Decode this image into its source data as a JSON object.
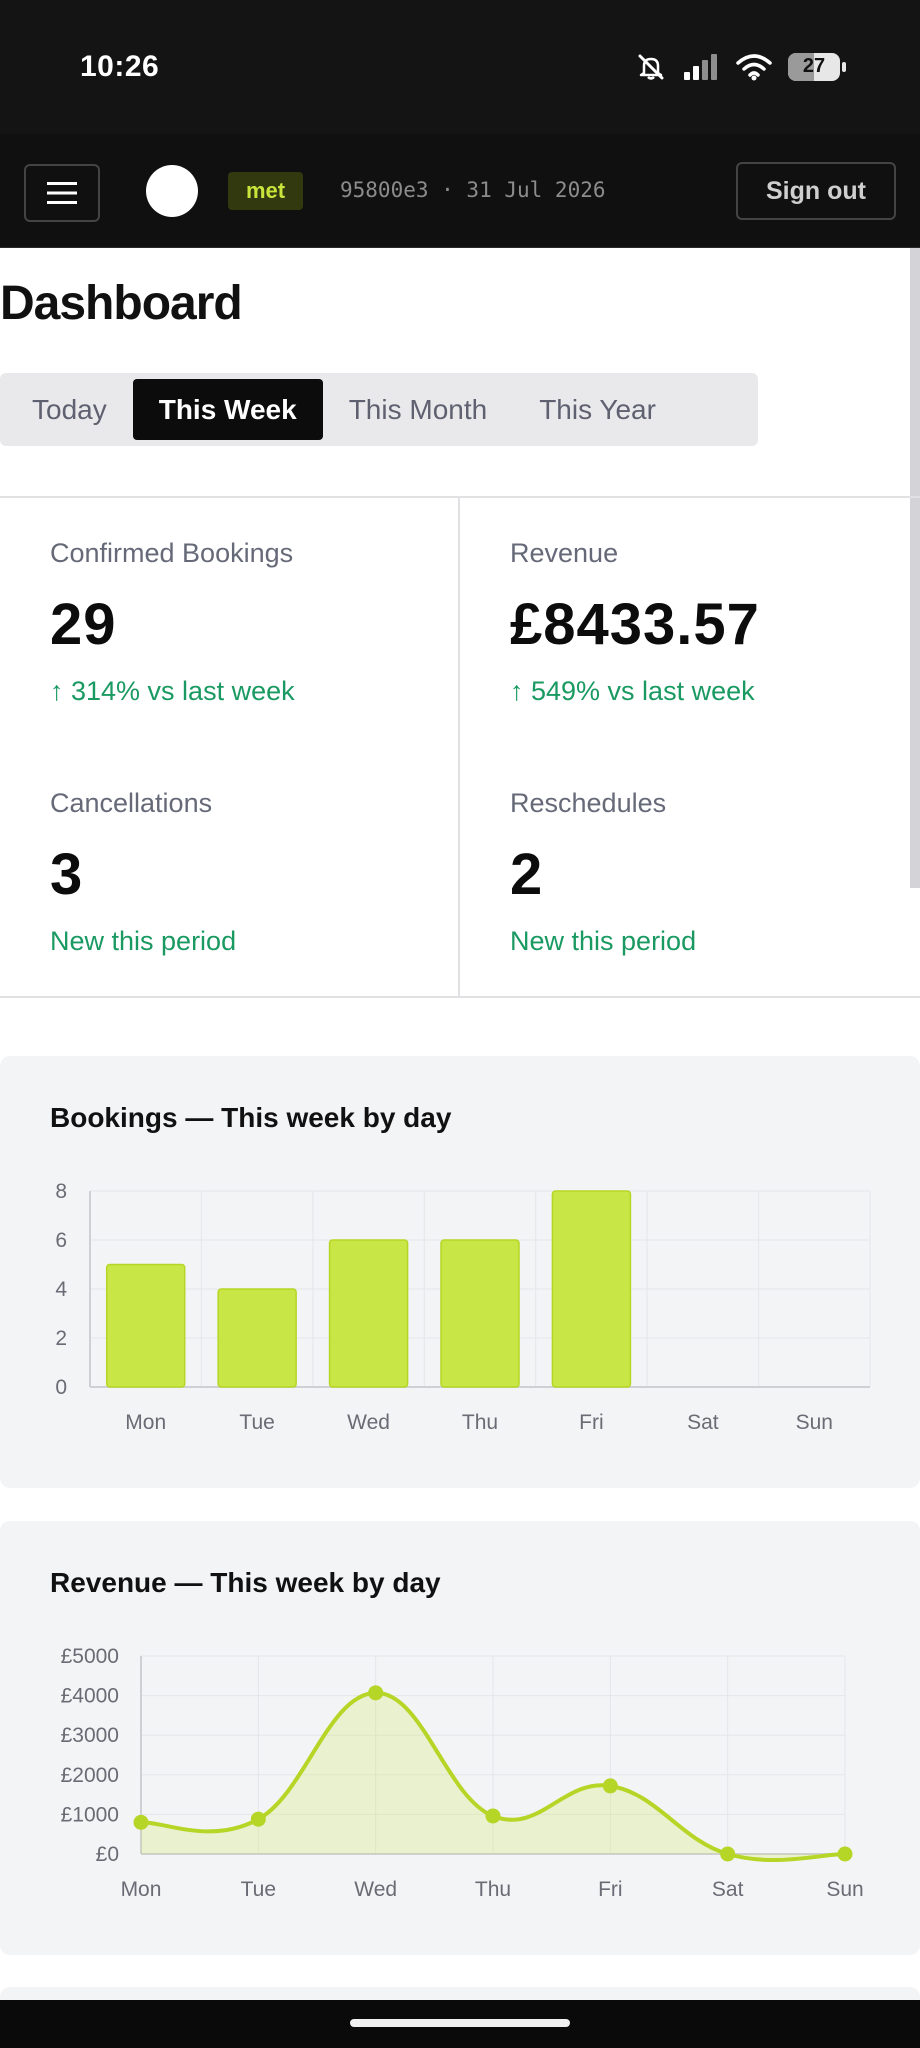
{
  "status_bar": {
    "time": "10:26",
    "battery": "27"
  },
  "header": {
    "env_badge": "met",
    "build_info": "95800e3 · 31 Jul 2026",
    "signout_label": "Sign out"
  },
  "page": {
    "title": "Dashboard"
  },
  "tabs": [
    {
      "label": "Today",
      "active": false
    },
    {
      "label": "This Week",
      "active": true
    },
    {
      "label": "This Month",
      "active": false
    },
    {
      "label": "This Year",
      "active": false
    }
  ],
  "stats": [
    {
      "label": "Confirmed Bookings",
      "value": "29",
      "delta": "↑ 314% vs last week"
    },
    {
      "label": "Revenue",
      "value": "£8433.57",
      "delta": "↑ 549% vs last week"
    },
    {
      "label": "Cancellations",
      "value": "3",
      "delta": "New this period"
    },
    {
      "label": "Reschedules",
      "value": "2",
      "delta": "New this period"
    }
  ],
  "colors": {
    "accent": "#c8e645",
    "accent_stroke": "#b5d626",
    "positive": "#1a9a62",
    "header_bg": "#101010"
  },
  "icons": {
    "menu": "menu-icon",
    "mute": "bell-off-icon",
    "signal": "signal-icon",
    "wifi": "wifi-icon",
    "battery": "battery-icon"
  },
  "chart_data": [
    {
      "type": "bar",
      "title": "Bookings — This week by day",
      "categories": [
        "Mon",
        "Tue",
        "Wed",
        "Thu",
        "Fri",
        "Sat",
        "Sun"
      ],
      "values": [
        5,
        4,
        6,
        6,
        8,
        0,
        0
      ],
      "ylim": [
        0,
        8
      ],
      "yticks": [
        "0",
        "2",
        "4",
        "6",
        "8"
      ],
      "grid": true,
      "xlabel": "",
      "ylabel": ""
    },
    {
      "type": "area",
      "title": "Revenue — This week by day",
      "categories": [
        "Mon",
        "Tue",
        "Wed",
        "Thu",
        "Fri",
        "Sat",
        "Sun"
      ],
      "values": [
        800,
        880,
        4070,
        960,
        1720,
        0,
        0
      ],
      "ylim": [
        0,
        5000
      ],
      "yticks": [
        "£0",
        "£1000",
        "£2000",
        "£3000",
        "£4000",
        "£5000"
      ],
      "grid": true,
      "xlabel": "",
      "ylabel": ""
    }
  ]
}
